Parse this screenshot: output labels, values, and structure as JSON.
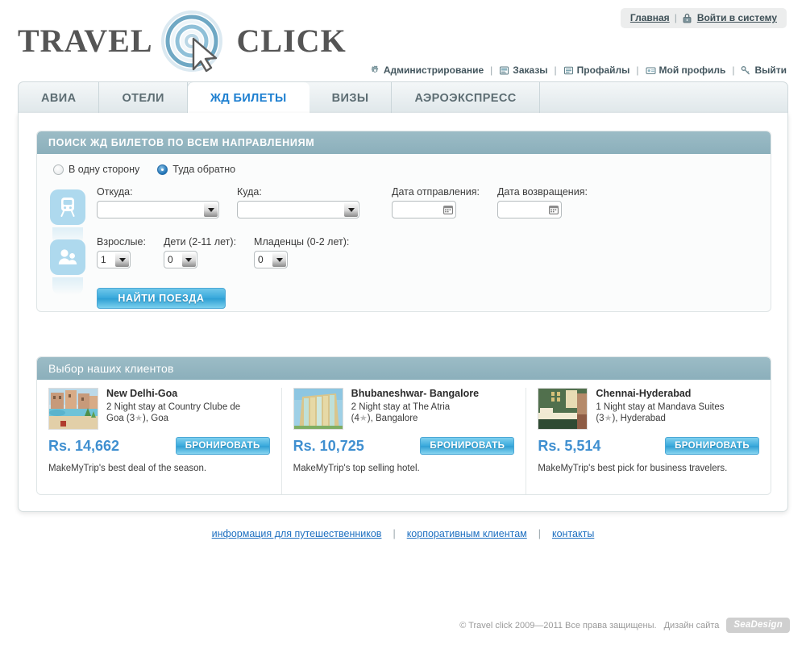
{
  "brand": {
    "word_left": "TRAVEL",
    "word_right": "CLICK",
    "logo_icon": "spiral-cursor-logo"
  },
  "auth": {
    "home_label": "Главная",
    "separator": "|",
    "login_label": "Войти в систему",
    "login_icon": "lock-icon"
  },
  "admin_nav": {
    "separator": "|",
    "items": [
      {
        "label": "Администрирование",
        "icon": "gear-icon"
      },
      {
        "label": "Заказы",
        "icon": "orders-icon"
      },
      {
        "label": "Профайлы",
        "icon": "profiles-icon"
      },
      {
        "label": "Мой профиль",
        "icon": "id-card-icon"
      },
      {
        "label": "Выйти",
        "icon": "key-icon"
      }
    ]
  },
  "tabs": [
    {
      "label": "АВИА",
      "active": false
    },
    {
      "label": "ОТЕЛИ",
      "active": false
    },
    {
      "label": "ЖД БИЛЕТЫ",
      "active": true
    },
    {
      "label": "ВИЗЫ",
      "active": false
    },
    {
      "label": "АЭРОЭКСПРЕСС",
      "active": false
    }
  ],
  "search": {
    "header": "ПОИСК ЖД БИЛЕТОВ ПО ВСЕМ НАПРАВЛЕНИЯМ",
    "trip_type": {
      "one_way_label": "В одну сторону",
      "one_way_selected": false,
      "round_trip_label": "Туда обратно",
      "round_trip_selected": true
    },
    "route_icon": "train-icon",
    "pax_icon": "passengers-icon",
    "from_label": "Откуда:",
    "from_value": "",
    "to_label": "Куда:",
    "to_value": "",
    "depart_label": "Дата отправления:",
    "depart_value": "",
    "return_label": "Дата возвращения:",
    "return_value": "",
    "calendar_icon": "calendar-icon",
    "adults_label": "Взрослые:",
    "adults_value": "1",
    "children_label": "Дети (2-11 лет):",
    "children_value": "0",
    "infants_label": "Младенцы (0-2 лет):",
    "infants_value": "0",
    "submit_label": "НАЙТИ ПОЕЗДА"
  },
  "deals": {
    "header": "Выбор наших клиентов",
    "book_label": "БРОНИРОВАТЬ",
    "items": [
      {
        "thumb": "resort-pool-photo",
        "title": "New Delhi-Goa",
        "desc_line1": "2 Night stay at Country Clube de",
        "desc_line2_pre": "Goa (3",
        "desc_line2_post": "), Goa",
        "stars": "3",
        "price": "Rs. 14,662",
        "note": "MakeMyTrip's best deal of the season."
      },
      {
        "thumb": "glass-building-photo",
        "title": "Bhubaneshwar- Bangalore",
        "desc_line1": "2 Night stay at The Atria",
        "desc_line2_pre": "(4",
        "desc_line2_post": "), Bangalore",
        "stars": "4",
        "price": "Rs. 10,725",
        "note": "MakeMyTrip's top selling hotel."
      },
      {
        "thumb": "hotel-room-photo",
        "title": "Chennai-Hyderabad",
        "desc_line1": "1 Night stay at Mandava Suites",
        "desc_line2_pre": "(3",
        "desc_line2_post": "), Hyderabad",
        "stars": "3",
        "price": "Rs. 5,514",
        "note": "MakeMyTrip's best pick for business travelers."
      }
    ]
  },
  "footer": {
    "separator": "|",
    "links": [
      "информация для путешественников",
      "корпоративным клиентам",
      "контакты"
    ],
    "copyright": "© Travel click  2009—2011  Все права защищены.",
    "design_label": "Дизайн сайта",
    "design_studio": "SeaDesign"
  },
  "colors": {
    "accent_blue": "#1d7fd0",
    "section_header": "#8bafbb",
    "button_blue": "#39a9dc",
    "price_blue": "#3f8fd0",
    "link_blue": "#1d6fc0"
  }
}
